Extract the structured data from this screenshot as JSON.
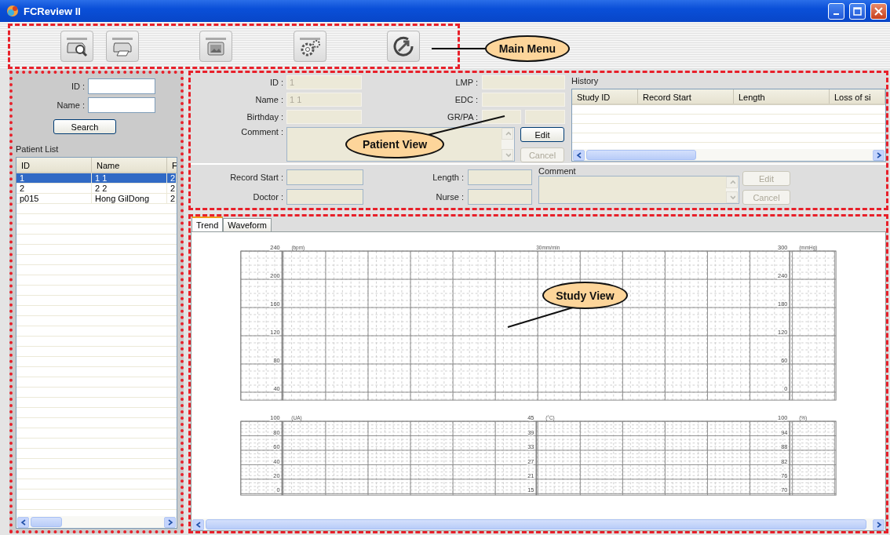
{
  "window": {
    "title": "FCReview II"
  },
  "toolbar": {
    "buttons": [
      {
        "kind": "print_preview"
      },
      {
        "kind": "print"
      },
      {
        "kind": "image"
      },
      {
        "kind": "settings"
      },
      {
        "kind": "rotate"
      }
    ]
  },
  "search": {
    "fields": [
      {
        "label": "ID :"
      },
      {
        "label": "Name :"
      }
    ],
    "button": "Search"
  },
  "patient_list": {
    "title": "Patient List",
    "columns": [
      "ID",
      "Name",
      "F"
    ],
    "rows": [
      {
        "cells": [
          "1",
          "1 1",
          "2"
        ],
        "selected": true
      },
      {
        "cells": [
          "2",
          "2 2",
          "2"
        ],
        "selected": false
      },
      {
        "cells": [
          "p015",
          "Hong GilDong",
          "2"
        ],
        "selected": false
      }
    ]
  },
  "patient": {
    "left_fields": [
      {
        "label": "ID :",
        "value": "1"
      },
      {
        "label": "Name :",
        "value": "1 1"
      },
      {
        "label": "Birthday :"
      }
    ],
    "right_fields": [
      {
        "label": "LMP :"
      },
      {
        "label": "EDC :"
      },
      {
        "label": "GR/PA :",
        "kind": "pair"
      }
    ],
    "comment_label": "Comment :",
    "buttons": [
      {
        "label": "Edit",
        "disabled": false
      },
      {
        "label": "Cancel",
        "disabled": true
      }
    ]
  },
  "history": {
    "title": "History",
    "columns": [
      "Study ID",
      "Record Start",
      "Length",
      "Loss of si"
    ]
  },
  "record": {
    "left_fields": [
      {
        "label": "Record Start :"
      },
      {
        "label": "Doctor :"
      }
    ],
    "right_fields": [
      {
        "label": "Length :"
      },
      {
        "label": "Nurse :"
      }
    ],
    "comment_label": "Comment",
    "buttons": [
      {
        "label": "Edit",
        "disabled": true
      },
      {
        "label": "Cancel",
        "disabled": true
      }
    ]
  },
  "study_tabs": [
    {
      "label": "Trend",
      "selected": true
    },
    {
      "label": "Waveform",
      "selected": false
    }
  ],
  "charts": [
    {
      "left_unit": "(bpm)",
      "left_ticks": [
        "240",
        "200",
        "160",
        "120",
        "80",
        "40"
      ],
      "center_label": "30mm/min",
      "right_unit": "(mmHg)",
      "right_ticks": [
        "300",
        "240",
        "180",
        "120",
        "60",
        "0"
      ]
    },
    {
      "left_unit": "(UA)",
      "left_ticks": [
        "100",
        "80",
        "60",
        "40",
        "20",
        "0"
      ],
      "center_unit": "(°C)",
      "center_ticks": [
        "45",
        "39",
        "33",
        "27",
        "21",
        "15"
      ],
      "right_unit": "(%)",
      "right_ticks": [
        "100",
        "94",
        "88",
        "82",
        "76",
        "70"
      ]
    }
  ],
  "callouts": [
    {
      "kind": "main_menu",
      "label": "Main Menu"
    },
    {
      "kind": "patient_view",
      "label": "Patient View"
    },
    {
      "kind": "study_view",
      "label": "Study View"
    }
  ]
}
